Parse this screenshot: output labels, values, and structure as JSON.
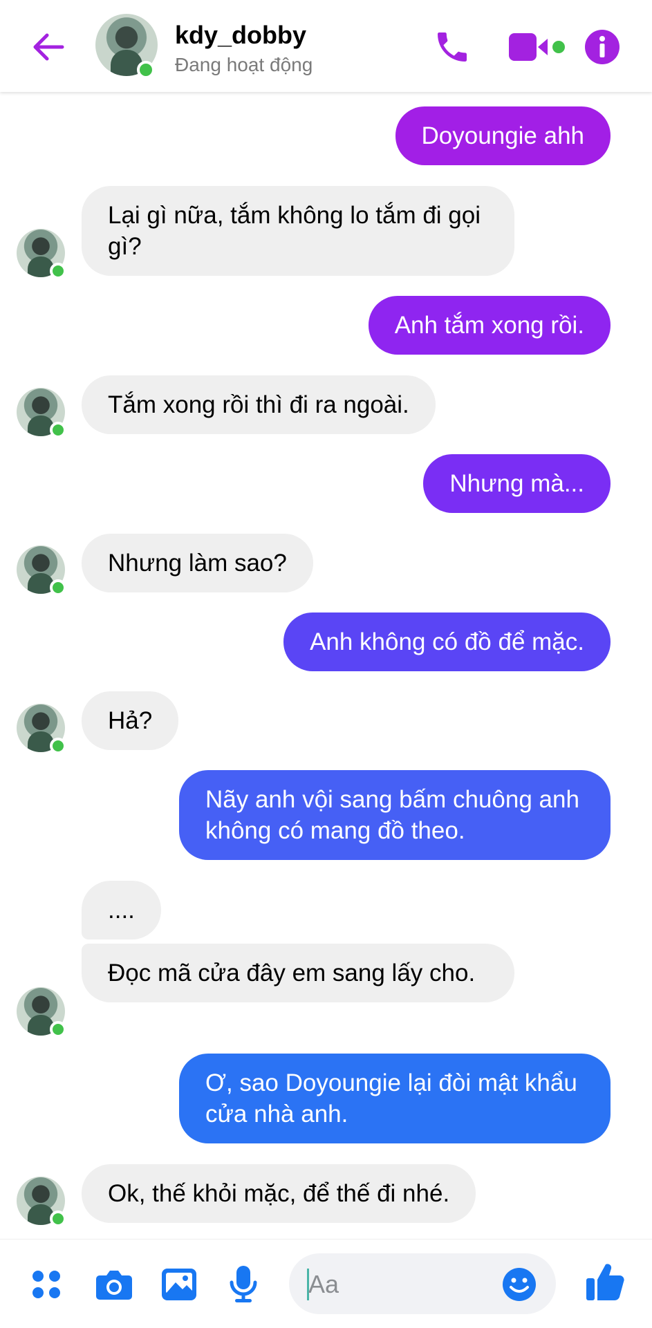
{
  "header": {
    "name": "kdy_dobby",
    "status": "Đang hoạt động",
    "icons": [
      "back-arrow-icon",
      "phone-icon",
      "video-camera-icon",
      "info-icon"
    ],
    "accent": "#a322e0"
  },
  "messages": [
    {
      "side": "out",
      "text": "Doyoungie ahh",
      "color": "#a21fe6"
    },
    {
      "side": "in",
      "text": "Lại gì nữa, tắm không lo tắm đi gọi gì?"
    },
    {
      "side": "out",
      "text": "Anh tắm xong rồi.",
      "color": "#8f25f0"
    },
    {
      "side": "in",
      "text": "Tắm xong rồi thì đi ra ngoài."
    },
    {
      "side": "out",
      "text": "Nhưng mà...",
      "color": "#7a2ef4"
    },
    {
      "side": "in",
      "text": "Nhưng làm sao?"
    },
    {
      "side": "out",
      "text": "Anh không có đồ để mặc.",
      "color": "#5a45f5"
    },
    {
      "side": "in",
      "text": "Hả?"
    },
    {
      "side": "out",
      "text": "Nãy anh vội sang bấm chuông anh không có mang đồ theo.",
      "color": "#4660f5"
    },
    {
      "side": "in",
      "text": "...."
    },
    {
      "side": "in",
      "text": "Đọc mã cửa đây em sang lấy cho."
    },
    {
      "side": "out",
      "text": "Ơ, sao Doyoungie lại đòi mật khẩu cửa nhà anh.",
      "color": "#2b73f4"
    },
    {
      "side": "in",
      "text": "Ok, thế khỏi mặc, để thế đi nhé."
    }
  ],
  "composer": {
    "placeholder": "Aa",
    "icons": [
      "apps-icon",
      "camera-icon",
      "gallery-icon",
      "microphone-icon",
      "emoji-icon",
      "like-icon"
    ],
    "accent": "#1877f2"
  }
}
